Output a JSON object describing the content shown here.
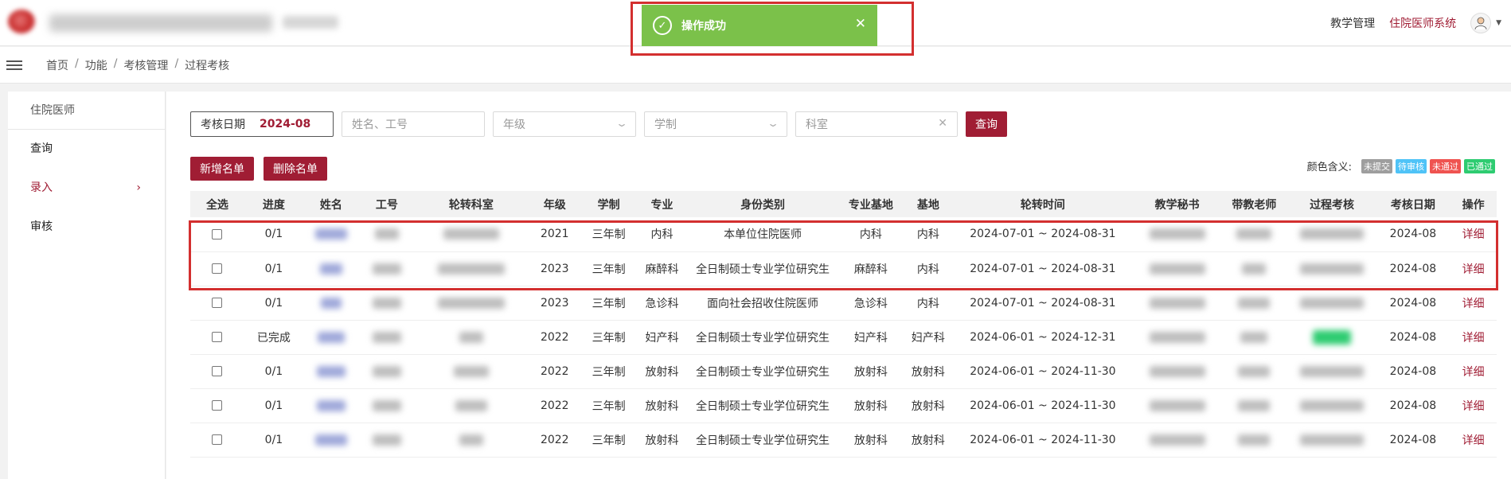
{
  "topbar": {
    "links": [
      {
        "label": "教学管理",
        "active": false
      },
      {
        "label": "住院医师系统",
        "active": true
      }
    ],
    "accent_color": "#a01d34"
  },
  "toast": {
    "message": "操作成功",
    "close_glyph": "✕",
    "background": "#7bc14a"
  },
  "breadcrumb": [
    "首页",
    "功能",
    "考核管理",
    "过程考核"
  ],
  "breadcrumb_sep": "/",
  "sidebar": {
    "header": "住院医师",
    "items": [
      {
        "label": "查询",
        "active": false
      },
      {
        "label": "录入",
        "active": true,
        "has_arrow": true
      },
      {
        "label": "审核",
        "active": false
      }
    ]
  },
  "filters": {
    "date_label": "考核日期",
    "date_value": "2024-08",
    "name_placeholder": "姓名、工号",
    "grade_placeholder": "年级",
    "system_placeholder": "学制",
    "dept_placeholder": "科室",
    "query_button": "查询"
  },
  "actions": {
    "add_button": "新增名单",
    "delete_button": "删除名单"
  },
  "legend": {
    "label": "颜色含义:",
    "tags": [
      {
        "label": "未提交",
        "color": "#9e9e9e"
      },
      {
        "label": "待审核",
        "color": "#4fc3f7"
      },
      {
        "label": "未通过",
        "color": "#ef5350"
      },
      {
        "label": "已通过",
        "color": "#2ecc71"
      }
    ]
  },
  "table": {
    "columns": [
      "全选",
      "进度",
      "姓名",
      "工号",
      "轮转科室",
      "年级",
      "学制",
      "专业",
      "身份类别",
      "专业基地",
      "基地",
      "轮转时间",
      "教学秘书",
      "带教老师",
      "过程考核",
      "考核日期",
      "操作"
    ],
    "rows": [
      {
        "progress": "0/1",
        "grade": "2021",
        "system": "三年制",
        "major": "内科",
        "identity": "本单位住院医师",
        "major_base": "内科",
        "base": "内科",
        "period": "2024-07-01 ~ 2024-08-31",
        "exam_date": "2024-08",
        "action": "详细",
        "status": "none"
      },
      {
        "progress": "0/1",
        "grade": "2023",
        "system": "三年制",
        "major": "麻醉科",
        "identity": "全日制硕士专业学位研究生",
        "major_base": "麻醉科",
        "base": "内科",
        "period": "2024-07-01 ~ 2024-08-31",
        "exam_date": "2024-08",
        "action": "详细",
        "status": "none"
      },
      {
        "progress": "0/1",
        "grade": "2023",
        "system": "三年制",
        "major": "急诊科",
        "identity": "面向社会招收住院医师",
        "major_base": "急诊科",
        "base": "内科",
        "period": "2024-07-01 ~ 2024-08-31",
        "exam_date": "2024-08",
        "action": "详细",
        "status": "none"
      },
      {
        "progress": "已完成",
        "grade": "2022",
        "system": "三年制",
        "major": "妇产科",
        "identity": "全日制硕士专业学位研究生",
        "major_base": "妇产科",
        "base": "妇产科",
        "period": "2024-06-01 ~ 2024-12-31",
        "exam_date": "2024-08",
        "action": "详细",
        "status": "passed"
      },
      {
        "progress": "0/1",
        "grade": "2022",
        "system": "三年制",
        "major": "放射科",
        "identity": "全日制硕士专业学位研究生",
        "major_base": "放射科",
        "base": "放射科",
        "period": "2024-06-01 ~ 2024-11-30",
        "exam_date": "2024-08",
        "action": "详细",
        "status": "none"
      },
      {
        "progress": "0/1",
        "grade": "2022",
        "system": "三年制",
        "major": "放射科",
        "identity": "全日制硕士专业学位研究生",
        "major_base": "放射科",
        "base": "放射科",
        "period": "2024-06-01 ~ 2024-11-30",
        "exam_date": "2024-08",
        "action": "详细",
        "status": "none"
      },
      {
        "progress": "0/1",
        "grade": "2022",
        "system": "三年制",
        "major": "放射科",
        "identity": "全日制硕士专业学位研究生",
        "major_base": "放射科",
        "base": "放射科",
        "period": "2024-06-01 ~ 2024-11-30",
        "exam_date": "2024-08",
        "action": "详细",
        "status": "none"
      }
    ]
  }
}
